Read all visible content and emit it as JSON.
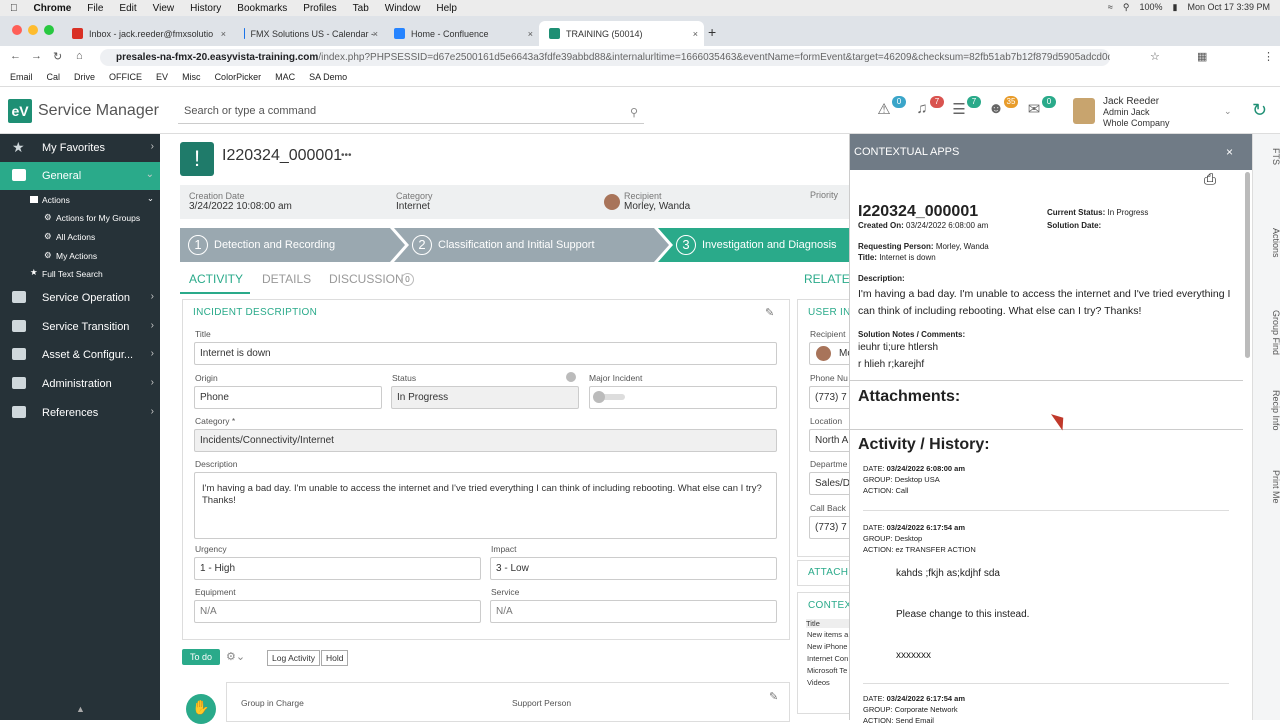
{
  "mac_menu": {
    "app": "Chrome",
    "items": [
      "File",
      "Edit",
      "View",
      "History",
      "Bookmarks",
      "Profiles",
      "Tab",
      "Window",
      "Help"
    ],
    "status": "100%",
    "clock": "Mon Oct 17  3:39 PM"
  },
  "browser": {
    "tabs": [
      {
        "label": "Inbox - jack.reeder@fmxsolutio",
        "color": "#d93025"
      },
      {
        "label": "FMX Solutions US - Calendar -",
        "color": "#1a73e8"
      },
      {
        "label": "Home - Confluence",
        "color": "#2684ff"
      },
      {
        "label": "TRAINING (50014)",
        "color": "#1e8f74"
      }
    ],
    "url_host": "presales-na-fmx-20.easyvista-training.com",
    "url_path": "/index.php?PHPSESSID=d67e2500161d5e6643a3fdfe39abbd88&internalurltime=1666035463&eventName=formEvent&target=46209&checksum=82fb51ab7b12f879d5905adcd0db...",
    "bookmarks": [
      "Email",
      "Cal",
      "Drive",
      "OFFICE",
      "EV",
      "Misc",
      "ColorPicker",
      "MAC",
      "SA Demo"
    ]
  },
  "header": {
    "logo": "eV",
    "app_name": "Service Manager",
    "search_placeholder": "Search or type a command",
    "badges": [
      "0",
      "7",
      "7",
      "35",
      "0"
    ],
    "user_name": "Jack Reeder",
    "user_role": "Admin Jack",
    "user_company": "Whole Company"
  },
  "sidebar": {
    "favorites": "My Favorites",
    "general": "General",
    "actions": "Actions",
    "sub": [
      "Actions for My Groups",
      "All Actions",
      "My Actions"
    ],
    "full_text": "Full Text Search",
    "items": [
      "Service Operation",
      "Service Transition",
      "Asset & Configur...",
      "Administration",
      "References"
    ]
  },
  "incident": {
    "id": "I220324_000001",
    "more": "•••",
    "creation_label": "Creation Date",
    "creation_value": "3/24/2022 10:08:00 am",
    "category_label": "Category",
    "category_value": "Internet",
    "recipient_label": "Recipient",
    "recipient_value": "Morley, Wanda",
    "priority_label": "Priority",
    "steps": [
      "Detection and Recording",
      "Classification and Initial Support",
      "Investigation and Diagnosis"
    ],
    "tabs": [
      "ACTIVITY",
      "DETAILS",
      "DISCUSSION"
    ],
    "discussion_count": "0",
    "related": "RELATE",
    "panel_title": "INCIDENT DESCRIPTION",
    "title_label": "Title",
    "title_value": "Internet is down",
    "origin_label": "Origin",
    "origin_value": "Phone",
    "status_label": "Status",
    "status_value": "In Progress",
    "major_label": "Major Incident",
    "cat_label": "Category *",
    "cat_value": "Incidents/Connectivity/Internet",
    "desc_label": "Description",
    "desc_value": "I'm having a bad day. I'm unable to access the internet and I've tried everything I can think of including rebooting. What else can I try? Thanks!",
    "urgency_label": "Urgency",
    "urgency_value": "1 - High",
    "impact_label": "Impact",
    "impact_value": "3 - Low",
    "equipment_label": "Equipment",
    "equipment_value": "N/A",
    "service_label": "Service",
    "service_value": "N/A",
    "todo": "To do",
    "log_activity": "Log Activity",
    "hold": "Hold",
    "group_label": "Group in Charge",
    "support_label": "Support Person",
    "user_panel_title": "USER IN",
    "ui_recipient": "Recipient",
    "ui_recipient_val": "Mo",
    "ui_phone": "Phone Nu",
    "ui_phone_val": "(773) 7",
    "ui_location": "Location",
    "ui_location_val": "North A",
    "ui_dept": "Departme",
    "ui_dept_val": "Sales/D",
    "ui_callback": "Call Back",
    "ui_callback_val": "(773) 7",
    "attach_title": "ATTACHM",
    "context_title": "CONTEXT",
    "ctx_col": "Title",
    "ctx_rows": [
      "New items a",
      "New iPhone",
      "Internet Con",
      "Microsoft Te",
      "Videos"
    ]
  },
  "ctx": {
    "title": "CONTEXTUAL APPS",
    "close": "×",
    "id": "I220324_000001",
    "created_label": "Created On:",
    "created_value": "03/24/2022 6:08:00 am",
    "status_label": "Current Status:",
    "status_value": "In Progress",
    "solution_label": "Solution Date:",
    "req_label": "Requesting Person:",
    "req_value": "Morley, Wanda",
    "title_label": "Title:",
    "title_value": "Internet is down",
    "desc_label": "Description:",
    "desc_value": "I'm having a bad day. I'm unable to access the internet and I've tried everything I can think of including rebooting. What else can I try? Thanks!",
    "notes_label": "Solution Notes / Comments:",
    "notes_1": "ieuhr ti;ure htlersh",
    "notes_2": "r hlieh r;karejhf",
    "attachments": "Attachments:",
    "history": "Activity / History:",
    "entries": [
      {
        "date": "03/24/2022 6:08:00 am",
        "group": "Desktop USA",
        "action": "Call"
      },
      {
        "date": "03/24/2022 6:17:54 am",
        "group": "Desktop",
        "action": "ez TRANSFER ACTION"
      },
      {
        "date": "03/24/2022 6:17:54 am",
        "group": "Corporate Network",
        "action": "Send Email"
      }
    ],
    "date_k": "DATE:",
    "group_k": "GROUP:",
    "action_k": "ACTION:",
    "msg1": "kahds ;fkjh as;kdjhf sda",
    "msg2": "Please change to this instead.",
    "msg3": "xxxxxxx"
  },
  "rail": [
    "FTS",
    "Actions",
    "Group Find",
    "Recip Info",
    "Print Me"
  ]
}
